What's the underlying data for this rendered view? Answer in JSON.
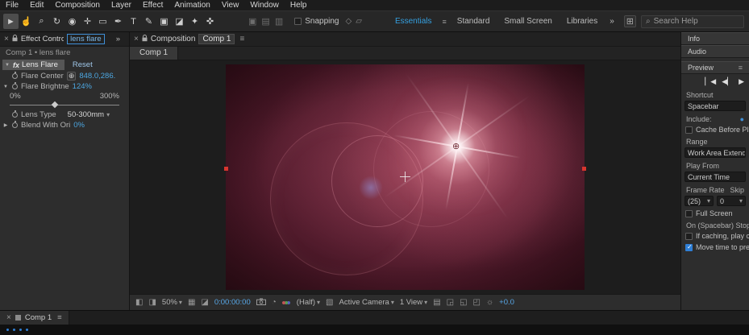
{
  "colors": {
    "accent": "#4ca6e0",
    "workspace_active": "#35a0e0",
    "handle_red": "#d8362e"
  },
  "icons": {
    "close": "×",
    "chevrons": "»",
    "menu": "≡",
    "tri_down": "▼",
    "tri_right": "▶",
    "dd": "▾",
    "crosshair": "⊕",
    "fx": "fx",
    "search": "⌕",
    "panel_grid": "⊞",
    "jump_start": "▏◀",
    "prev_frame": "◀▏",
    "play": "▶",
    "include_video": "●",
    "exposure_sun": "☼",
    "flare_point": "⊕"
  },
  "menubar": {
    "items": [
      "File",
      "Edit",
      "Composition",
      "Layer",
      "Effect",
      "Animation",
      "View",
      "Window",
      "Help"
    ]
  },
  "toolbar": {
    "tools": [
      {
        "name": "selection-tool",
        "glyph": "►"
      },
      {
        "name": "hand-tool",
        "glyph": "☝"
      },
      {
        "name": "zoom-tool",
        "glyph": "⌕"
      },
      {
        "name": "rotation-tool",
        "glyph": "↻"
      },
      {
        "name": "camera-tool",
        "glyph": "◉"
      },
      {
        "name": "pan-behind-tool",
        "glyph": "✛"
      },
      {
        "name": "shape-tool",
        "glyph": "▭"
      },
      {
        "name": "pen-tool",
        "glyph": "✒"
      },
      {
        "name": "type-tool",
        "glyph": "T"
      },
      {
        "name": "brush-tool",
        "glyph": "✎"
      },
      {
        "name": "clone-stamp-tool",
        "glyph": "▣"
      },
      {
        "name": "eraser-tool",
        "glyph": "◪"
      },
      {
        "name": "roto-brush-tool",
        "glyph": "✦"
      },
      {
        "name": "puppet-pin-tool",
        "glyph": "✜"
      }
    ],
    "tool_options": [
      "▣",
      "▤",
      "▥"
    ],
    "snapping_label": "Snapping",
    "snap_icons": [
      "◇",
      "▱"
    ],
    "workspaces": [
      "Essentials",
      "Standard",
      "Small Screen",
      "Libraries"
    ],
    "search_placeholder": "Search Help"
  },
  "effect_controls": {
    "panel_title": "Effect Controls",
    "doc_tab": "lens flare",
    "breadcrumb": "Comp 1 • lens flare",
    "effect_name": "Lens Flare",
    "reset_label": "Reset",
    "slider_handle_style": "left:41%",
    "params": {
      "flare_center": {
        "label": "Flare Center",
        "value": "848.0,286."
      },
      "flare_brightness": {
        "label": "Flare Brightne",
        "value": "124%",
        "min": "0%",
        "max": "300%"
      },
      "lens_type": {
        "label": "Lens Type",
        "value": "50-300mm"
      },
      "blend": {
        "label": "Blend With Ori",
        "value": "0%"
      }
    }
  },
  "composition": {
    "panel_title": "Composition",
    "doc_tab": "Comp 1",
    "viewer_tab": "Comp 1",
    "statusbar": {
      "zoom": "50%",
      "timecode": "0:00:00:00",
      "resolution": "(Half)",
      "camera_view": "Active Camera",
      "view_layout": "1 View",
      "exposure": "+0.0"
    },
    "statusbar_icons": [
      "◧",
      "◨",
      "▦",
      "◪",
      "◔",
      "▧",
      "▤",
      "◲",
      "◱",
      "◰"
    ]
  },
  "preview": {
    "info_label": "Info",
    "audio_label": "Audio",
    "preview_label": "Preview",
    "shortcut_label": "Shortcut",
    "shortcut_value": "Spacebar",
    "include_label": "Include:",
    "cache_label": "Cache Before Play",
    "range_label": "Range",
    "range_value": "Work Area Extended",
    "play_from_label": "Play From",
    "play_from_value": "Current Time",
    "frame_rate_label": "Frame Rate",
    "skip_label": "Skip",
    "frame_rate_value": "(25)",
    "skip_value": "0",
    "full_screen_label": "Full Screen",
    "stop_label": "On (Spacebar) Stop:",
    "if_caching_label": "If caching, play ca",
    "move_time_label": "Move time to pre"
  },
  "timeline": {
    "tab": "Comp 1"
  }
}
